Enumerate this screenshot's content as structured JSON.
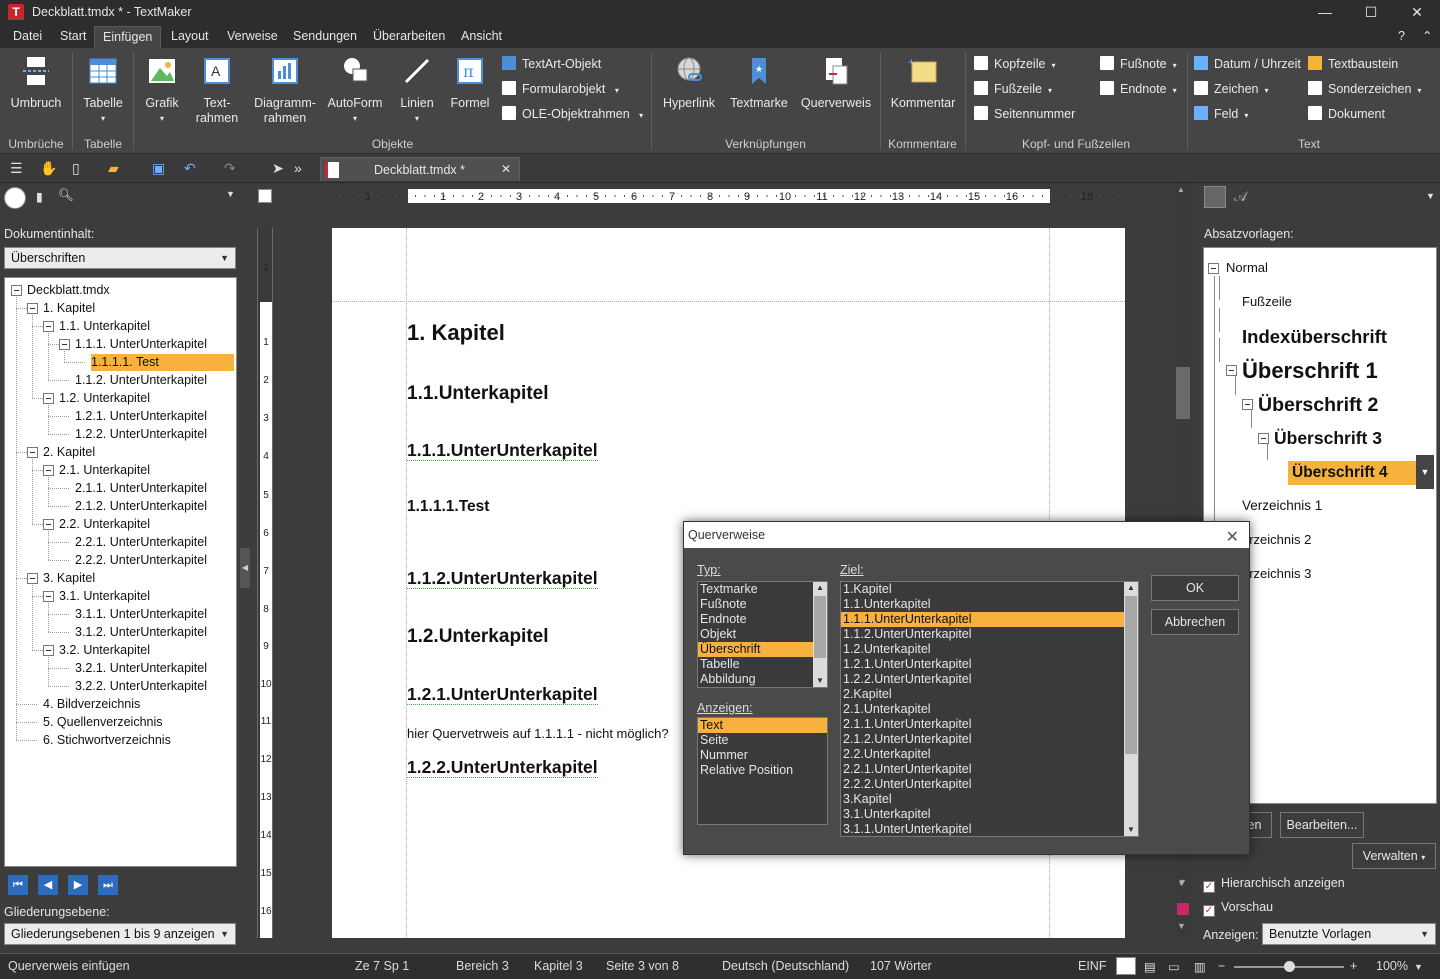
{
  "window": {
    "title": "Deckblatt.tmdx * - TextMaker",
    "logo": "T",
    "minimize": "—",
    "maximize": "☐",
    "close": "✕"
  },
  "menu": [
    "Datei",
    "Start",
    "Einfügen",
    "Layout",
    "Verweise",
    "Sendungen",
    "Überarbeiten",
    "Ansicht"
  ],
  "menu_right": {
    "help": "?",
    "collapse": "⌃"
  },
  "ribbon": {
    "umbruch": "Umbruch",
    "tabelle": "Tabelle",
    "grafik": "Grafik",
    "textrahmen": "Text-rahmen",
    "diagrammrahmen": "Diagramm-rahmen",
    "autoform": "AutoForm",
    "linien": "Linien",
    "formel": "Formel",
    "textart": "TextArt-Objekt",
    "formularobjekt": "Formularobjekt",
    "oleobjektrahmen": "OLE-Objektrahmen",
    "hyperlink": "Hyperlink",
    "textmarke": "Textmarke",
    "querverweis": "Querverweis",
    "kommentar": "Kommentar",
    "kopfzeile": "Kopfzeile",
    "fusszeile": "Fußzeile",
    "seitennummer": "Seitennummer",
    "fussnote": "Fußnote",
    "endnote": "Endnote",
    "datum": "Datum / Uhrzeit",
    "zeichen": "Zeichen",
    "feld": "Feld",
    "textbaustein": "Textbaustein",
    "sonderzeichen": "Sonderzeichen",
    "dokument": "Dokument",
    "groups": {
      "umbrueche": "Umbrüche",
      "tabelle": "Tabelle",
      "objekte": "Objekte",
      "verknuepfungen": "Verknüpfungen",
      "kommentare": "Kommentare",
      "kopffuss": "Kopf- und Fußzeilen",
      "text": "Text"
    }
  },
  "doc_tab": {
    "name": "Deckblatt.tmdx *",
    "close": "✕"
  },
  "left_panel": {
    "dokumentinhalt_label": "Dokumentinhalt:",
    "filter": "Überschriften",
    "gliederungsebene_label": "Gliederungsebene:",
    "gliederung_value": "Gliederungsebenen 1 bis 9 anzeigen",
    "tree": [
      {
        "t": "Deckblatt.tmdx",
        "lvl": 0,
        "box": true
      },
      {
        "t": "1. Kapitel",
        "lvl": 1,
        "box": true
      },
      {
        "t": "1.1. Unterkapitel",
        "lvl": 2,
        "box": true
      },
      {
        "t": "1.1.1. UnterUnterkapitel",
        "lvl": 3,
        "box": true
      },
      {
        "t": "1.1.1.1. Test",
        "lvl": 4,
        "box": false,
        "sel": true
      },
      {
        "t": "1.1.2. UnterUnterkapitel",
        "lvl": 3,
        "box": false
      },
      {
        "t": "1.2. Unterkapitel",
        "lvl": 2,
        "box": true
      },
      {
        "t": "1.2.1. UnterUnterkapitel",
        "lvl": 3,
        "box": false
      },
      {
        "t": "1.2.2. UnterUnterkapitel",
        "lvl": 3,
        "box": false
      },
      {
        "t": "2. Kapitel",
        "lvl": 1,
        "box": true
      },
      {
        "t": "2.1. Unterkapitel",
        "lvl": 2,
        "box": true
      },
      {
        "t": "2.1.1. UnterUnterkapitel",
        "lvl": 3,
        "box": false
      },
      {
        "t": "2.1.2. UnterUnterkapitel",
        "lvl": 3,
        "box": false
      },
      {
        "t": "2.2. Unterkapitel",
        "lvl": 2,
        "box": true
      },
      {
        "t": "2.2.1. UnterUnterkapitel",
        "lvl": 3,
        "box": false
      },
      {
        "t": "2.2.2. UnterUnterkapitel",
        "lvl": 3,
        "box": false
      },
      {
        "t": "3. Kapitel",
        "lvl": 1,
        "box": true
      },
      {
        "t": "3.1. Unterkapitel",
        "lvl": 2,
        "box": true
      },
      {
        "t": "3.1.1. UnterUnterkapitel",
        "lvl": 3,
        "box": false
      },
      {
        "t": "3.1.2. UnterUnterkapitel",
        "lvl": 3,
        "box": false
      },
      {
        "t": "3.2. Unterkapitel",
        "lvl": 2,
        "box": true
      },
      {
        "t": "3.2.1. UnterUnterkapitel",
        "lvl": 3,
        "box": false
      },
      {
        "t": "3.2.2. UnterUnterkapitel",
        "lvl": 3,
        "box": false
      },
      {
        "t": "4. Bildverzeichnis",
        "lvl": 1,
        "box": false
      },
      {
        "t": "5. Quellenverzeichnis",
        "lvl": 1,
        "box": false
      },
      {
        "t": "6. Stichwortverzeichnis",
        "lvl": 1,
        "box": false
      }
    ]
  },
  "ruler": {
    "h_numbers": [
      "1",
      "1",
      "2",
      "3",
      "4",
      "5",
      "6",
      "7",
      "8",
      "9",
      "10",
      "11",
      "12",
      "13",
      "14",
      "15",
      "16",
      "18"
    ],
    "v_numbers": [
      "1",
      "1",
      "2",
      "3",
      "4",
      "5",
      "6",
      "7",
      "8",
      "9",
      "10",
      "11",
      "12",
      "13",
      "14",
      "15",
      "16"
    ]
  },
  "document": {
    "headings": [
      {
        "text": "1. Kapitel",
        "size": 22,
        "wavy": false
      },
      {
        "text": "1.1.Unterkapitel",
        "size": 19,
        "wavy": false
      },
      {
        "text": "1.1.1.UnterUnterkapitel",
        "size": 17.5,
        "wavy": true
      },
      {
        "text": "1.1.1.1.Test",
        "size": 15.5,
        "wavy": false
      },
      {
        "text": "1.1.2.UnterUnterkapitel",
        "size": 17.5,
        "wavy": true
      },
      {
        "text": "1.2.Unterkapitel",
        "size": 19,
        "wavy": false
      },
      {
        "text": "1.2.1.UnterUnterkapitel",
        "size": 17.5,
        "wavy": true
      },
      {
        "text": "1.2.2.UnterUnterkapitel",
        "size": 17.5,
        "wavy": true
      }
    ],
    "body": "hier Quervetrweis auf 1.1.1.1 - nicht möglich?"
  },
  "right_panel": {
    "label": "Absatzvorlagen:",
    "styles": [
      {
        "t": "Normal",
        "size": 13,
        "bold": false
      },
      {
        "t": "Fußzeile",
        "size": 13,
        "bold": false
      },
      {
        "t": "Indexüberschrift",
        "size": 18.5,
        "bold": true
      },
      {
        "t": "Überschrift 1",
        "size": 22,
        "bold": true
      },
      {
        "t": "Überschrift 2",
        "size": 19.5,
        "bold": true
      },
      {
        "t": "Überschrift 3",
        "size": 17.5,
        "bold": true
      },
      {
        "t": "Überschrift 4",
        "size": 15.5,
        "bold": true,
        "sel": true
      },
      {
        "t": "Verzeichnis 1",
        "size": 13.5,
        "bold": false
      },
      {
        "t": "erzeichnis 2",
        "size": 13,
        "bold": false
      },
      {
        "t": "erzeichnis 3",
        "size": 13,
        "bold": false
      }
    ],
    "btn_left": "den",
    "btn_edit": "Bearbeiten...",
    "btn_verwalten": "Verwalten",
    "hierarchisch": "Hierarchisch anzeigen",
    "vorschau": "Vorschau",
    "anzeigen_label": "Anzeigen:",
    "anzeigen_value": "Benutzte Vorlagen"
  },
  "dialog": {
    "title": "Querverweise",
    "typ_label": "Typ:",
    "typ_items": [
      "Textmarke",
      "Fußnote",
      "Endnote",
      "Objekt",
      "Überschrift",
      "Tabelle",
      "Abbildung"
    ],
    "typ_selected": 4,
    "anzeigen_label": "Anzeigen:",
    "anzeigen_items": [
      "Text",
      "Seite",
      "Nummer",
      "Relative Position"
    ],
    "anzeigen_selected": 0,
    "ziel_label": "Ziel:",
    "ziel_items": [
      "1.Kapitel",
      "1.1.Unterkapitel",
      "1.1.1.UnterUnterkapitel",
      "1.1.2.UnterUnterkapitel",
      "1.2.Unterkapitel",
      "1.2.1.UnterUnterkapitel",
      "1.2.2.UnterUnterkapitel",
      "2.Kapitel",
      "2.1.Unterkapitel",
      "2.1.1.UnterUnterkapitel",
      "2.1.2.UnterUnterkapitel",
      "2.2.Unterkapitel",
      "2.2.1.UnterUnterkapitel",
      "2.2.2.UnterUnterkapitel",
      "3.Kapitel",
      "3.1.Unterkapitel",
      "3.1.1.UnterUnterkapitel"
    ],
    "ziel_selected": 2,
    "ok": "OK",
    "cancel": "Abbrechen"
  },
  "status": {
    "action": "Querverweis einfügen",
    "pos": "Ze 7 Sp 1",
    "bereich": "Bereich 3",
    "kapitel": "Kapitel 3",
    "seite": "Seite 3 von 8",
    "sprache": "Deutsch (Deutschland)",
    "woerter": "107 Wörter",
    "modus": "EINF",
    "zoom": "100%"
  },
  "colors": {
    "accent": "#f6b23c",
    "dark": "#3c3c3c"
  }
}
